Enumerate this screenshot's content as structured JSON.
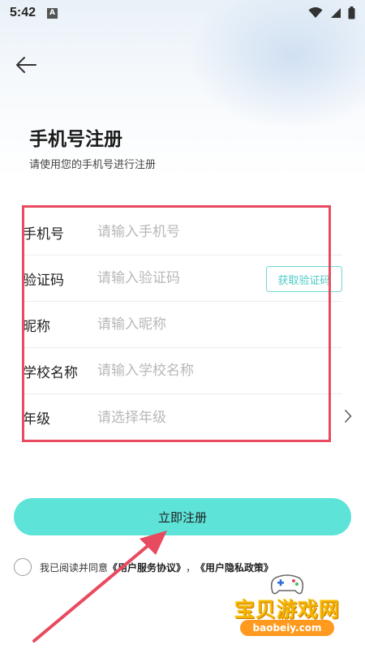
{
  "status_bar": {
    "time": "5:42",
    "notif_letter": "A"
  },
  "header": {
    "title": "手机号注册",
    "subtitle": "请使用您的手机号进行注册"
  },
  "form": {
    "fields": [
      {
        "label": "手机号",
        "placeholder": "请输入手机号"
      },
      {
        "label": "验证码",
        "placeholder": "请输入验证码",
        "action": "获取验证码"
      },
      {
        "label": "昵称",
        "placeholder": "请输入昵称"
      },
      {
        "label": "学校名称",
        "placeholder": "请输入学校名称"
      },
      {
        "label": "年级",
        "placeholder": "请选择年级"
      }
    ]
  },
  "submit_label": "立即注册",
  "agreement": {
    "prefix": "我已阅读并同意",
    "service_link": "《用户服务协议》",
    "separator": "，",
    "privacy_link": "《用户隐私政策》"
  },
  "watermark": {
    "text": "宝贝游戏网",
    "url": "baobeiy.com"
  },
  "colors": {
    "accent": "#5de3d8",
    "annotation": "#e84a5f",
    "watermark": "#f5b400"
  }
}
